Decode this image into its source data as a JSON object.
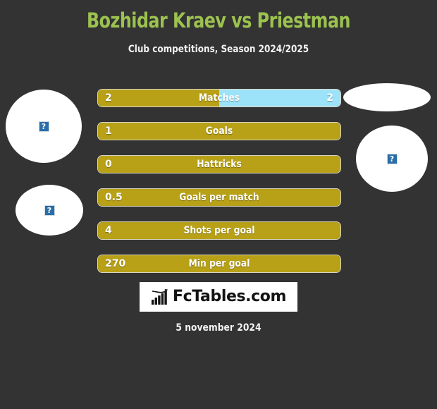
{
  "header": {
    "title": "Bozhidar Kraev vs Priestman",
    "subtitle": "Club competitions, Season 2024/2025",
    "title_color": "#9cc24f"
  },
  "colors": {
    "background": "#333333",
    "bar_home": "#b8a117",
    "bar_away": "#9ce3fa",
    "bar_outline": "#d9d7c4",
    "text": "#ffffff"
  },
  "photos": {
    "home_top": {
      "alt": "?"
    },
    "home_bottom": {
      "alt": "?"
    },
    "away_top": {
      "alt": ""
    },
    "away_bottom": {
      "alt": "?"
    }
  },
  "stats": [
    {
      "label": "Matches",
      "home": "2",
      "away": "2",
      "home_pct": 50,
      "away_pct": 50
    },
    {
      "label": "Goals",
      "home": "1",
      "away": "",
      "home_pct": 100,
      "away_pct": 0
    },
    {
      "label": "Hattricks",
      "home": "0",
      "away": "",
      "home_pct": 100,
      "away_pct": 0
    },
    {
      "label": "Goals per match",
      "home": "0.5",
      "away": "",
      "home_pct": 100,
      "away_pct": 0
    },
    {
      "label": "Shots per goal",
      "home": "4",
      "away": "",
      "home_pct": 100,
      "away_pct": 0
    },
    {
      "label": "Min per goal",
      "home": "270",
      "away": "",
      "home_pct": 100,
      "away_pct": 0
    }
  ],
  "logo": {
    "text": "FcTables.com",
    "icon": "bar-chart-growth-icon"
  },
  "footer": {
    "date": "5 november 2024"
  },
  "chart_data": {
    "type": "bar",
    "title": "Bozhidar Kraev vs Priestman",
    "subtitle": "Club competitions, Season 2024/2025",
    "categories": [
      "Matches",
      "Goals",
      "Hattricks",
      "Goals per match",
      "Shots per goal",
      "Min per goal"
    ],
    "series": [
      {
        "name": "Bozhidar Kraev",
        "values": [
          2,
          1,
          0,
          0.5,
          4,
          270
        ],
        "color": "#b8a117"
      },
      {
        "name": "Priestman",
        "values": [
          2,
          null,
          null,
          null,
          null,
          null
        ],
        "color": "#9ce3fa"
      }
    ],
    "orientation": "horizontal",
    "legend": "none",
    "grid": false
  }
}
